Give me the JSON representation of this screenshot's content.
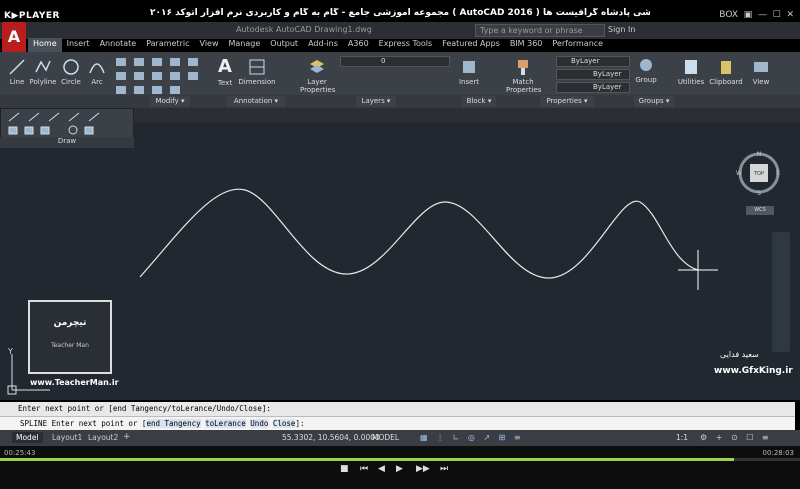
{
  "player": {
    "logo": "K▶PLAYER",
    "title": "مجموعه آموزشی جامع - گام به گام و کاربردی نرم افزار اتوکد ۲۰۱۶ ( AutoCAD 2016 ) مدرس : سعید فدایی (تیچرمن) گروه آموزشی پادشاه گرافیست ها",
    "box_label": "BOX",
    "time_elapsed": "00:25:43",
    "time_total": "00:28:03",
    "progress": 0.917
  },
  "acad": {
    "logo": "A",
    "doc_title": "Autodesk AutoCAD   Drawing1.dwg",
    "search_placeholder": "Type a keyword or phrase",
    "signin": "Sign In"
  },
  "ribbon": {
    "tabs": [
      "Home",
      "Insert",
      "Annotate",
      "Parametric",
      "View",
      "Manage",
      "Output",
      "Add-ins",
      "A360",
      "Express Tools",
      "Featured Apps",
      "BIM 360",
      "Performance"
    ],
    "active_tab": "Home",
    "draw_tools": [
      "Line",
      "Polyline",
      "Circle",
      "Arc"
    ],
    "text_label": "Text",
    "dimension_label": "Dimension",
    "layer_props_label": "Layer Properties",
    "insert_label": "Insert",
    "match_props_label": "Match Properties",
    "group_label": "Group",
    "utilities_label": "Utilities",
    "clipboard_label": "Clipboard",
    "view_label": "View",
    "layer_value": "0",
    "bylayer_1": "ByLayer",
    "bylayer_2": "ByLayer",
    "bylayer_3": "ByLayer",
    "panels": [
      "Modify ▾",
      "Annotation ▾",
      "Layers ▾",
      "Block ▾",
      "Properties ▾",
      "Groups ▾"
    ],
    "draw_panel_label": "Draw"
  },
  "viewcube": {
    "top": "TOP",
    "n": "N",
    "s": "S",
    "e": "E",
    "w": "W",
    "wcs": "WCS"
  },
  "watermarks": {
    "teacherman_site": "www.TeacherMan.ir",
    "teacherman_caption": "Teacher Man",
    "teacherman_logo": "تیچرمن",
    "gfx_site": "www.GfxKing.ir",
    "gfx_name": "سعید فدایی"
  },
  "command": {
    "history": "Enter next point or [end Tangency/toLerance/Undo/Close]:",
    "prompt_prefix": "SPLINE Enter next point or [",
    "opt1": "end Tangency",
    "opt2": "toLerance",
    "opt3": "Undo",
    "opt4": "Close",
    "prompt_suffix": "]:"
  },
  "status": {
    "tabs": [
      "Model",
      "Layout1",
      "Layout2"
    ],
    "active_tab": "Model",
    "coords": "55.3302, 10.5604, 0.0000",
    "model": "MODEL",
    "scale": "1:1"
  }
}
